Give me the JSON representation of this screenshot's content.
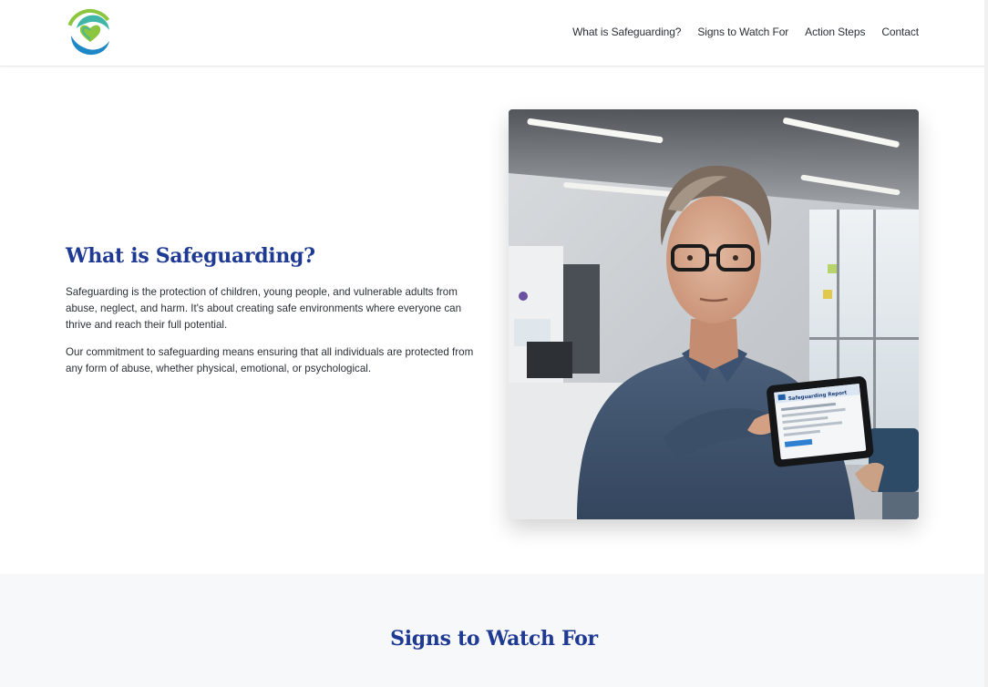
{
  "nav": {
    "items": [
      {
        "label": "What is Safeguarding?"
      },
      {
        "label": "Signs to Watch For"
      },
      {
        "label": "Action Steps"
      },
      {
        "label": "Contact"
      }
    ]
  },
  "logo": {
    "icon": "hands-heart-logo-icon",
    "colors": {
      "green": "#8cc63f",
      "blue": "#1e88c7",
      "teal": "#3fb6a8"
    }
  },
  "hero": {
    "title": "What is Safeguarding?",
    "paragraphs": [
      "Safeguarding is the protection of children, young people, and vulnerable adults from abuse, neglect, and harm. It's about creating safe environments where everyone can thrive and reach their full potential.",
      "Our commitment to safeguarding means ensuring that all individuals are protected from any form of abuse, whether physical, emotional, or psychological."
    ],
    "image": {
      "icon": "person-holding-tablet-photo",
      "tablet_text": "Safeguarding Report"
    }
  },
  "signs": {
    "title": "Signs to Watch For"
  },
  "colors": {
    "accent": "#1f3a93",
    "section_bg": "#f7f8fa"
  }
}
